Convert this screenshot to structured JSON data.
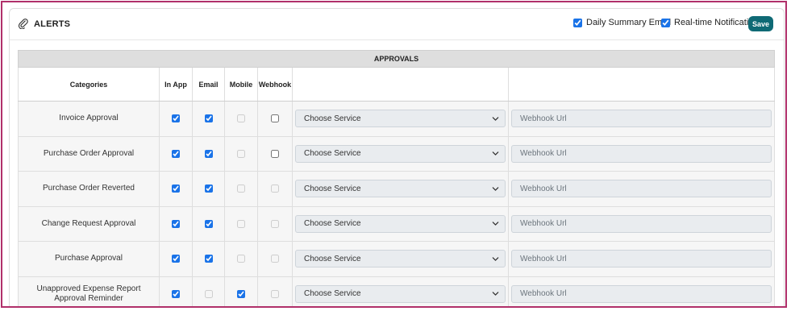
{
  "header": {
    "title": "ALERTS",
    "icon": "paperclip-icon",
    "daily_summary": {
      "label": "Daily Summary Email",
      "checked": true
    },
    "realtime": {
      "label": "Real-time Notification",
      "checked": true
    },
    "save_label": "Save"
  },
  "table": {
    "group_title": "APPROVALS",
    "columns": {
      "categories": "Categories",
      "in_app": "In App",
      "email": "Email",
      "mobile": "Mobile",
      "webhook": "Webhook"
    },
    "service_placeholder": "Choose Service",
    "webhook_placeholder": "Webhook Url",
    "rows": [
      {
        "category": "Invoice Approval",
        "in_app": true,
        "email": true,
        "mobile": false,
        "mobile_disabled": true,
        "webhook": false,
        "webhook_disabled": false
      },
      {
        "category": "Purchase Order Approval",
        "in_app": true,
        "email": true,
        "mobile": false,
        "mobile_disabled": true,
        "webhook": false,
        "webhook_disabled": false
      },
      {
        "category": "Purchase Order Reverted",
        "in_app": true,
        "email": true,
        "mobile": false,
        "mobile_disabled": true,
        "webhook": false,
        "webhook_disabled": true
      },
      {
        "category": "Change Request Approval",
        "in_app": true,
        "email": true,
        "mobile": false,
        "mobile_disabled": true,
        "webhook": false,
        "webhook_disabled": true
      },
      {
        "category": "Purchase Approval",
        "in_app": true,
        "email": true,
        "mobile": false,
        "mobile_disabled": true,
        "webhook": false,
        "webhook_disabled": true
      },
      {
        "category": "Unapproved Expense Report Approval Reminder",
        "in_app": true,
        "email": false,
        "email_disabled": true,
        "mobile": true,
        "mobile_disabled": false,
        "webhook": false,
        "webhook_disabled": true
      }
    ]
  },
  "colors": {
    "accent": "#0f6a75",
    "frame": "#b0306a",
    "checkbox": "#1a73e8"
  }
}
